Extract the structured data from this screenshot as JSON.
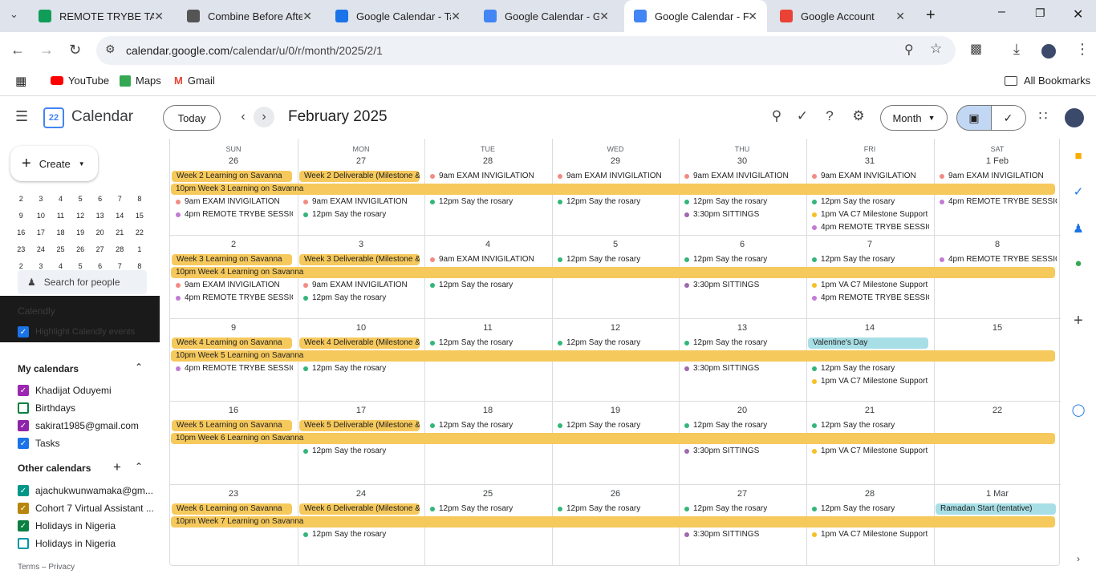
{
  "browser": {
    "tabs": [
      {
        "title": "REMOTE TRYBE TASK",
        "icon": "google-drive-icon",
        "color": "#0f9d58"
      },
      {
        "title": "Combine Before After",
        "icon": "web-icon",
        "color": "#555555"
      },
      {
        "title": "Google Calendar - Tasks",
        "icon": "tasks-icon",
        "color": "#1a73e8"
      },
      {
        "title": "Google Calendar - Ge",
        "icon": "calendar-icon",
        "color": "#4285f4"
      },
      {
        "title": "Google Calendar - Fe",
        "icon": "calendar-icon",
        "color": "#4285f4"
      },
      {
        "title": "Google Account",
        "icon": "google-icon",
        "color": "#ea4335"
      }
    ],
    "url_host": "calendar.google.com",
    "url_path": "/calendar/u/0/r/month/2025/2/1",
    "bookmarks": [
      "YouTube",
      "Maps",
      "Gmail"
    ],
    "all_bookmarks": "All Bookmarks"
  },
  "header": {
    "app_name": "Calendar",
    "logo_text": "22",
    "today": "Today",
    "month_title": "February 2025",
    "view": "Month"
  },
  "sidebar": {
    "create": "Create",
    "mini_calendar": [
      [
        "2",
        "3",
        "4",
        "5",
        "6",
        "7",
        "8"
      ],
      [
        "9",
        "10",
        "11",
        "12",
        "13",
        "14",
        "15"
      ],
      [
        "16",
        "17",
        "18",
        "19",
        "20",
        "21",
        "22"
      ],
      [
        "23",
        "24",
        "25",
        "26",
        "27",
        "28",
        "1"
      ],
      [
        "2",
        "3",
        "4",
        "5",
        "6",
        "7",
        "8"
      ]
    ],
    "search_people": "Search for people",
    "calendly_title": "Calendly",
    "calendly_option": "Highlight Calendly events",
    "my_calendars_title": "My calendars",
    "my_calendars": [
      {
        "name": "Khadijat Oduyemi",
        "checked": true,
        "color": "#9c27b0"
      },
      {
        "name": "Birthdays",
        "checked": false,
        "color": "#0b8043"
      },
      {
        "name": "sakirat1985@gmail.com",
        "checked": true,
        "color": "#8e24aa"
      },
      {
        "name": "Tasks",
        "checked": true,
        "color": "#1a73e8"
      }
    ],
    "other_calendars_title": "Other calendars",
    "other_calendars": [
      {
        "name": "ajachukwunwamaka@gm...",
        "checked": true,
        "color": "#009688"
      },
      {
        "name": "Cohort 7 Virtual Assistant ...",
        "checked": true,
        "color": "#b8860b"
      },
      {
        "name": "Holidays in Nigeria",
        "checked": true,
        "color": "#0b8043"
      },
      {
        "name": "Holidays in Nigeria",
        "checked": false,
        "color": "#0097a7"
      }
    ],
    "footer": "Terms – Privacy"
  },
  "grid": {
    "weekdays": [
      "SUN",
      "MON",
      "TUE",
      "WED",
      "THU",
      "FRI",
      "SAT"
    ],
    "colors": {
      "banner": "#f6c95c",
      "holiday": "#a8dfe6",
      "green": "#33b679",
      "red": "#f28b82",
      "purple": "#9e69af",
      "orchid": "#c27ad4",
      "yellow": "#f6bf26"
    },
    "weeks": [
      {
        "dates": [
          "26",
          "27",
          "28",
          "29",
          "30",
          "31",
          "1 Feb"
        ],
        "banner": "10pm Week 3 Learning on Savanna",
        "chips": [
          {
            "col": 0,
            "text": "Week 2 Learning on Savanna",
            "kind": "banner"
          },
          {
            "col": 1,
            "text": "Week 2 Deliverable (Milestone &",
            "kind": "banner"
          }
        ],
        "events": [
          {
            "col": 2,
            "line": 0,
            "dot": "red",
            "text": "9am EXAM INVIGILATION"
          },
          {
            "col": 3,
            "line": 0,
            "dot": "red",
            "text": "9am EXAM INVIGILATION"
          },
          {
            "col": 4,
            "line": 0,
            "dot": "red",
            "text": "9am EXAM INVIGILATION"
          },
          {
            "col": 5,
            "line": 0,
            "dot": "red",
            "text": "9am EXAM INVIGILATION"
          },
          {
            "col": 6,
            "line": 0,
            "dot": "red",
            "text": "9am EXAM INVIGILATION"
          },
          {
            "col": 0,
            "line": 2,
            "dot": "red",
            "text": "9am EXAM INVIGILATION"
          },
          {
            "col": 1,
            "line": 2,
            "dot": "red",
            "text": "9am EXAM INVIGILATION"
          },
          {
            "col": 2,
            "line": 2,
            "dot": "green",
            "text": "12pm Say the rosary"
          },
          {
            "col": 3,
            "line": 2,
            "dot": "green",
            "text": "12pm Say the rosary"
          },
          {
            "col": 4,
            "line": 2,
            "dot": "green",
            "text": "12pm Say the rosary"
          },
          {
            "col": 5,
            "line": 2,
            "dot": "green",
            "text": "12pm Say the rosary"
          },
          {
            "col": 6,
            "line": 2,
            "dot": "orchid",
            "text": "4pm REMOTE TRYBE SESSIO"
          },
          {
            "col": 0,
            "line": 3,
            "dot": "orchid",
            "text": "4pm REMOTE TRYBE SESSIO"
          },
          {
            "col": 1,
            "line": 3,
            "dot": "green",
            "text": "12pm Say the rosary"
          },
          {
            "col": 4,
            "line": 3,
            "dot": "purple",
            "text": "3:30pm SITTINGS"
          },
          {
            "col": 5,
            "line": 3,
            "dot": "yellow",
            "text": "1pm VA C7 Milestone Support"
          },
          {
            "col": 5,
            "line": 4,
            "dot": "orchid",
            "text": "4pm REMOTE TRYBE SESSIO"
          }
        ]
      },
      {
        "dates": [
          "2",
          "3",
          "4",
          "5",
          "6",
          "7",
          "8"
        ],
        "banner": "10pm Week 4 Learning on Savanna",
        "chips": [
          {
            "col": 0,
            "text": "Week 3 Learning on Savanna",
            "kind": "banner"
          },
          {
            "col": 1,
            "text": "Week 3 Deliverable (Milestone &",
            "kind": "banner"
          }
        ],
        "events": [
          {
            "col": 2,
            "line": 0,
            "dot": "red",
            "text": "9am EXAM INVIGILATION"
          },
          {
            "col": 3,
            "line": 0,
            "dot": "green",
            "text": "12pm Say the rosary"
          },
          {
            "col": 4,
            "line": 0,
            "dot": "green",
            "text": "12pm Say the rosary"
          },
          {
            "col": 5,
            "line": 0,
            "dot": "green",
            "text": "12pm Say the rosary"
          },
          {
            "col": 6,
            "line": 0,
            "dot": "orchid",
            "text": "4pm REMOTE TRYBE SESSIO"
          },
          {
            "col": 0,
            "line": 2,
            "dot": "red",
            "text": "9am EXAM INVIGILATION"
          },
          {
            "col": 1,
            "line": 2,
            "dot": "red",
            "text": "9am EXAM INVIGILATION"
          },
          {
            "col": 2,
            "line": 2,
            "dot": "green",
            "text": "12pm Say the rosary"
          },
          {
            "col": 4,
            "line": 2,
            "dot": "purple",
            "text": "3:30pm SITTINGS"
          },
          {
            "col": 5,
            "line": 2,
            "dot": "yellow",
            "text": "1pm VA C7 Milestone Support"
          },
          {
            "col": 0,
            "line": 3,
            "dot": "orchid",
            "text": "4pm REMOTE TRYBE SESSIO"
          },
          {
            "col": 1,
            "line": 3,
            "dot": "green",
            "text": "12pm Say the rosary"
          },
          {
            "col": 5,
            "line": 3,
            "dot": "orchid",
            "text": "4pm REMOTE TRYBE SESSIO"
          }
        ]
      },
      {
        "dates": [
          "9",
          "10",
          "11",
          "12",
          "13",
          "14",
          "15"
        ],
        "banner": "10pm Week 5 Learning on Savanna",
        "chips": [
          {
            "col": 0,
            "text": "Week 4 Learning on Savanna",
            "kind": "banner"
          },
          {
            "col": 1,
            "text": "Week 4 Deliverable (Milestone &",
            "kind": "banner"
          },
          {
            "col": 5,
            "text": "Valentine's Day",
            "kind": "holiday"
          }
        ],
        "events": [
          {
            "col": 2,
            "line": 0,
            "dot": "green",
            "text": "12pm Say the rosary"
          },
          {
            "col": 3,
            "line": 0,
            "dot": "green",
            "text": "12pm Say the rosary"
          },
          {
            "col": 4,
            "line": 0,
            "dot": "green",
            "text": "12pm Say the rosary"
          },
          {
            "col": 0,
            "line": 2,
            "dot": "orchid",
            "text": "4pm REMOTE TRYBE SESSIO"
          },
          {
            "col": 1,
            "line": 2,
            "dot": "green",
            "text": "12pm Say the rosary"
          },
          {
            "col": 4,
            "line": 2,
            "dot": "purple",
            "text": "3:30pm SITTINGS"
          },
          {
            "col": 5,
            "line": 2,
            "dot": "green",
            "text": "12pm Say the rosary"
          },
          {
            "col": 5,
            "line": 3,
            "dot": "yellow",
            "text": "1pm VA C7 Milestone Support"
          }
        ]
      },
      {
        "dates": [
          "16",
          "17",
          "18",
          "19",
          "20",
          "21",
          "22"
        ],
        "banner": "10pm Week 6 Learning on Savanna",
        "chips": [
          {
            "col": 0,
            "text": "Week 5 Learning on Savanna",
            "kind": "banner"
          },
          {
            "col": 1,
            "text": "Week 5 Deliverable (Milestone &",
            "kind": "banner"
          }
        ],
        "events": [
          {
            "col": 2,
            "line": 0,
            "dot": "green",
            "text": "12pm Say the rosary"
          },
          {
            "col": 3,
            "line": 0,
            "dot": "green",
            "text": "12pm Say the rosary"
          },
          {
            "col": 4,
            "line": 0,
            "dot": "green",
            "text": "12pm Say the rosary"
          },
          {
            "col": 5,
            "line": 0,
            "dot": "green",
            "text": "12pm Say the rosary"
          },
          {
            "col": 1,
            "line": 2,
            "dot": "green",
            "text": "12pm Say the rosary"
          },
          {
            "col": 4,
            "line": 2,
            "dot": "purple",
            "text": "3:30pm SITTINGS"
          },
          {
            "col": 5,
            "line": 2,
            "dot": "yellow",
            "text": "1pm VA C7 Milestone Support"
          }
        ]
      },
      {
        "dates": [
          "23",
          "24",
          "25",
          "26",
          "27",
          "28",
          "1 Mar"
        ],
        "banner": "10pm Week 7 Learning on Savanna",
        "chips": [
          {
            "col": 0,
            "text": "Week 6 Learning on Savanna",
            "kind": "banner"
          },
          {
            "col": 1,
            "text": "Week 6 Deliverable (Milestone &",
            "kind": "banner"
          },
          {
            "col": 6,
            "text": "Ramadan Start (tentative)",
            "kind": "holiday"
          }
        ],
        "events": [
          {
            "col": 2,
            "line": 0,
            "dot": "green",
            "text": "12pm Say the rosary"
          },
          {
            "col": 3,
            "line": 0,
            "dot": "green",
            "text": "12pm Say the rosary"
          },
          {
            "col": 4,
            "line": 0,
            "dot": "green",
            "text": "12pm Say the rosary"
          },
          {
            "col": 5,
            "line": 0,
            "dot": "green",
            "text": "12pm Say the rosary"
          },
          {
            "col": 1,
            "line": 2,
            "dot": "green",
            "text": "12pm Say the rosary"
          },
          {
            "col": 4,
            "line": 2,
            "dot": "purple",
            "text": "3:30pm SITTINGS"
          },
          {
            "col": 5,
            "line": 2,
            "dot": "yellow",
            "text": "1pm VA C7 Milestone Support"
          }
        ]
      }
    ]
  }
}
